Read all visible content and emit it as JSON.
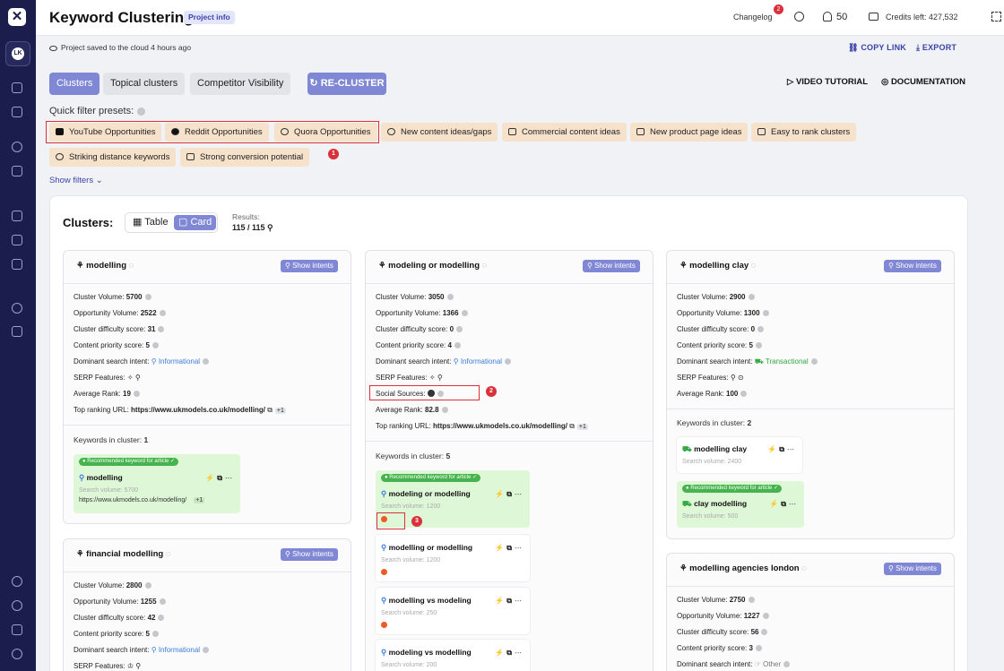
{
  "app": {
    "title": "Keyword Clustering",
    "project_info": "Project info",
    "changelog": "Changelog",
    "changelog_badge": "2",
    "notifications": "50",
    "credits": "Credits left: 427,532",
    "workspace": "LK"
  },
  "status": {
    "saved": "Project saved to the cloud 4 hours ago",
    "copy_link": "COPY LINK",
    "export": "EXPORT"
  },
  "tabs": [
    {
      "label": "Clusters"
    },
    {
      "label": "Topical clusters"
    },
    {
      "label": "Competitor Visibility"
    }
  ],
  "recluster": "RE-CLUSTER",
  "video_tutorial": "VIDEO TUTORIAL",
  "documentation": "DOCUMENTATION",
  "quick_filters": {
    "label": "Quick filter presets:",
    "chips": [
      "YouTube Opportunities",
      "Reddit Opportunities",
      "Quora Opportunities",
      "New content ideas/gaps",
      "Commercial content ideas",
      "New product page ideas",
      "Easy to rank clusters",
      "Striking distance keywords",
      "Strong conversion potential"
    ]
  },
  "annotations": [
    "1",
    "2",
    "3"
  ],
  "show_filters": "Show filters",
  "clusters_view": {
    "label": "Clusters:",
    "table": "Table",
    "card": "Card",
    "results_label": "Results:",
    "results_value": "115 / 115"
  },
  "labels": {
    "show_intents": "Show intents",
    "cluster_volume": "Cluster Volume:",
    "opportunity_volume": "Opportunity Volume:",
    "difficulty": "Cluster difficulty score:",
    "priority": "Content priority score:",
    "dominant_intent": "Dominant search intent:",
    "serp_features": "SERP Features:",
    "social_sources": "Social Sources:",
    "average_rank": "Average Rank:",
    "top_url": "Top ranking URL:",
    "keywords_in_cluster": "Keywords in cluster:",
    "recommended": "Recommended keyword for article",
    "search_volume": "Search volume:"
  },
  "cards": [
    {
      "name": "modelling",
      "volume": "5700",
      "opportunity": "2522",
      "difficulty": "31",
      "priority": "5",
      "intent": "Informational",
      "rank": "19",
      "url": "https://www.ukmodels.co.uk/modelling/",
      "url_more": "+1",
      "kw_count": "1",
      "keywords": [
        {
          "name": "modelling",
          "volume": "Search volume: 5700",
          "url": "https://www.ukmodels.co.uk/modelling/",
          "more": "+1"
        }
      ]
    },
    {
      "name": "modeling or modelling",
      "volume": "3050",
      "opportunity": "1366",
      "difficulty": "0",
      "priority": "4",
      "intent": "Informational",
      "rank": "82.8",
      "url": "https://www.ukmodels.co.uk/modelling/",
      "url_more": "+1",
      "kw_count": "5",
      "keywords": [
        {
          "name": "modeling or modelling",
          "volume": "Search volume: 1200"
        },
        {
          "name": "modelling or modelling",
          "volume": "Search volume: 1200"
        },
        {
          "name": "modelling vs modeling",
          "volume": "Search volume: 250"
        },
        {
          "name": "modeling vs modelling",
          "volume": "Search volume: 200"
        }
      ]
    },
    {
      "name": "modelling clay",
      "volume": "2900",
      "opportunity": "1300",
      "difficulty": "0",
      "priority": "5",
      "intent": "Transactional",
      "rank": "100",
      "kw_count": "2",
      "keywords": [
        {
          "name": "modelling clay",
          "volume": "Search volume: 2400"
        },
        {
          "name": "clay modelling",
          "volume": "Search volume: 500"
        }
      ]
    },
    {
      "name": "financial modelling",
      "volume": "2800",
      "opportunity": "1255",
      "difficulty": "42",
      "priority": "5",
      "intent": "Informational"
    },
    {
      "name": "modelling agencies london",
      "volume": "2750",
      "opportunity": "1227",
      "difficulty": "56",
      "priority": "3",
      "intent": "Other"
    }
  ]
}
